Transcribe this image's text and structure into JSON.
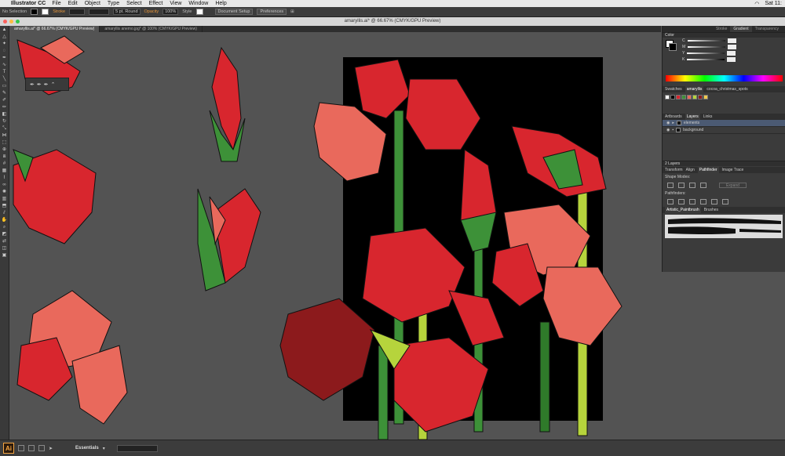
{
  "menubar": {
    "app": "Illustrator CC",
    "items": [
      "File",
      "Edit",
      "Object",
      "Type",
      "Select",
      "Effect",
      "View",
      "Window",
      "Help"
    ],
    "clock": "Sat 11:"
  },
  "control": {
    "selection": "No Selection",
    "stroke_label": "Stroke",
    "brush": "5 pt. Round",
    "opacity_label": "Opacity",
    "opacity_value": "100%",
    "style_label": "Style",
    "doc_setup": "Document Setup",
    "preferences": "Preferences"
  },
  "window_title": "amaryllis.ai* @ 66.67% (CMYK/GPU Preview)",
  "doc_tabs": [
    "amaryllis.ai* @ 66.67% (CMYK/GPU Preview)",
    "amaryllis anemo.jpg* @ 100% (CMYK/GPU Preview)"
  ],
  "statusbar": {
    "workspace": "Essentials"
  },
  "panels": {
    "panel_tabs": [
      "Stroke",
      "Gradient",
      "Transparency"
    ],
    "color_title": "Color",
    "color_channels": [
      "C",
      "M",
      "Y",
      "K"
    ],
    "swatch_tabs": [
      "Swatches",
      "amaryllis",
      "cocoa_christmas_spots"
    ],
    "layer_tabs": [
      "Artboards",
      "Layers",
      "Links"
    ],
    "layers": [
      {
        "name": "elements"
      },
      {
        "name": "background"
      }
    ],
    "layers_count": "2 Layers",
    "pf_tabs": [
      "Transform",
      "Align",
      "Pathfinder",
      "Image Trace"
    ],
    "shape_modes": "Shape Modes:",
    "expand": "Expand",
    "pathfinders": "Pathfinders:",
    "brush_tabs": [
      "Artistic_Paintbrush",
      "Brushes"
    ]
  },
  "colors": {
    "red": "#d8262e",
    "coral": "#e9695c",
    "darkred": "#8c1a1c",
    "green": "#3d9138",
    "lightgreen": "#b6d43c",
    "stem": "#2f7a2a"
  }
}
